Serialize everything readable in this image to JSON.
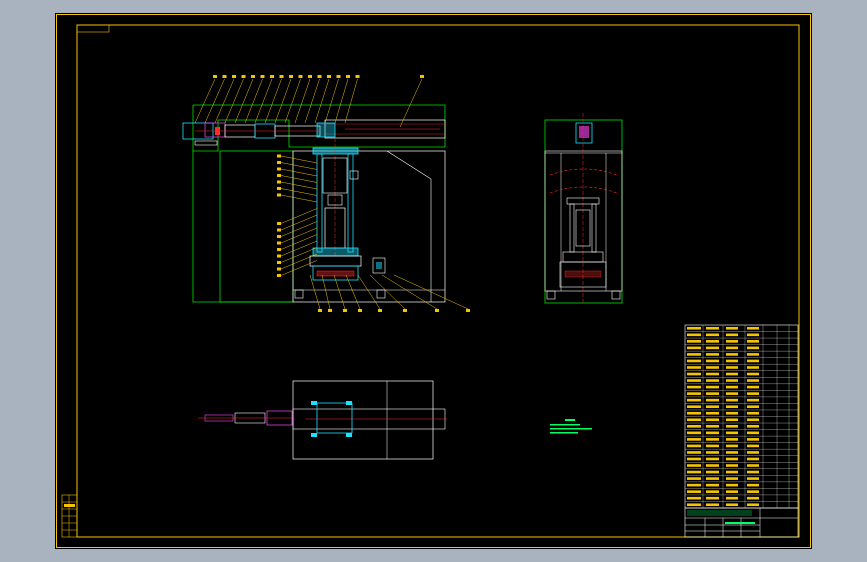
{
  "window": {
    "background": "#a9b3c0",
    "canvas_background": "#000000"
  },
  "colors": {
    "border": "#f5c400",
    "outline": "#00e600",
    "cyan": "#1ee0ff",
    "white": "#ffffff",
    "red": "#ff2a2a",
    "magenta": "#ff44ff",
    "yellow": "#f5c400",
    "note": "#00ff66"
  },
  "drawing": {
    "views": [
      "front-section-view",
      "side-view",
      "top-view"
    ],
    "technical_notes_lines": 3,
    "bom_rows": 28,
    "balloon_count_top": 16,
    "balloon_count_left": 16,
    "balloon_count_bottom": 8
  },
  "title_block": {
    "cell_count": 12
  }
}
